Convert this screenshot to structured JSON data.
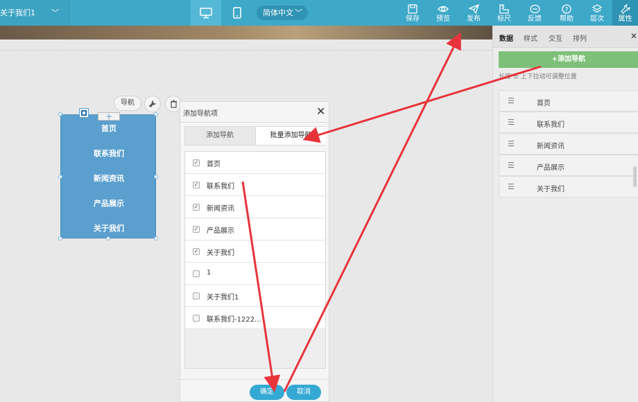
{
  "topbar": {
    "page_selector": "关于我们1",
    "language": "简体中文",
    "tools": [
      {
        "label": "保存",
        "icon": "save-icon"
      },
      {
        "label": "预览",
        "icon": "eye-icon"
      },
      {
        "label": "发布",
        "icon": "paper-plane-icon"
      },
      {
        "label": "标尺",
        "icon": "ruler-icon"
      },
      {
        "label": "反馈",
        "icon": "feedback-icon"
      },
      {
        "label": "帮助",
        "icon": "help-icon"
      },
      {
        "label": "层次",
        "icon": "layers-icon"
      },
      {
        "label": "属性",
        "icon": "wrench-icon"
      }
    ]
  },
  "widget_toolbar": {
    "nav_label": "导航"
  },
  "nav_widget": {
    "items": [
      "首页",
      "联系我们",
      "新闻资讯",
      "产品展示",
      "关于我们"
    ]
  },
  "dialog": {
    "title": "添加导航项",
    "tabs": [
      "添加导航",
      "批量添加导航"
    ],
    "items": [
      {
        "label": "首页",
        "checked": true
      },
      {
        "label": "联系我们",
        "checked": true
      },
      {
        "label": "新闻资讯",
        "checked": true
      },
      {
        "label": "产品展示",
        "checked": true
      },
      {
        "label": "关于我们",
        "checked": true
      },
      {
        "label": "1",
        "checked": false
      },
      {
        "label": "关于我们1",
        "checked": false
      },
      {
        "label": "联系我们-1222...",
        "checked": false
      }
    ],
    "ok_label": "确定",
    "cancel_label": "取消"
  },
  "right_panel": {
    "tabs": [
      "数据",
      "样式",
      "交互",
      "排列"
    ],
    "add_button": "+添加导航",
    "hint": "长按 ☰ 上下拉动可调整位置",
    "items": [
      "首页",
      "联系我们",
      "新闻资讯",
      "产品展示",
      "关于我们"
    ]
  },
  "colors": {
    "topbar": "#3ea8c8",
    "accent": "#34a9d3",
    "nav_widget": "#5b9fcf",
    "add_button": "#7ec07a",
    "annotation": "#e8333a"
  }
}
